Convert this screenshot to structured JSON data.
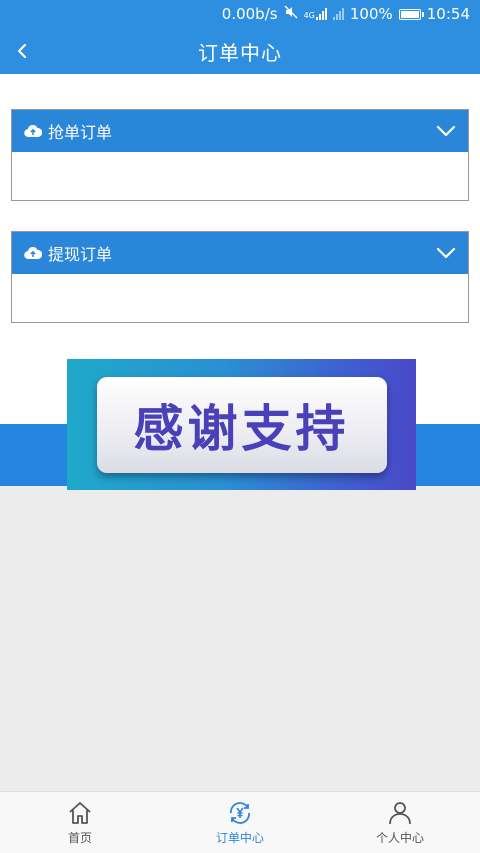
{
  "status_bar": {
    "speed": "0.00b/s",
    "net_type": "4G",
    "battery": "100%",
    "time": "10:54"
  },
  "header": {
    "title": "订单中心"
  },
  "panels": [
    {
      "label": "抢单订单"
    },
    {
      "label": "提现订单"
    }
  ],
  "banner": {
    "text": "感谢支持"
  },
  "tabbar": {
    "items": [
      {
        "label": "首页",
        "icon": "home-icon"
      },
      {
        "label": "订单中心",
        "icon": "yen-refresh-icon",
        "active": true
      },
      {
        "label": "个人中心",
        "icon": "person-icon"
      }
    ]
  },
  "colors": {
    "primary": "#2e8fe0",
    "panel_header": "#2a86d8",
    "active_tab": "#2e86d8",
    "background": "#ececec"
  }
}
